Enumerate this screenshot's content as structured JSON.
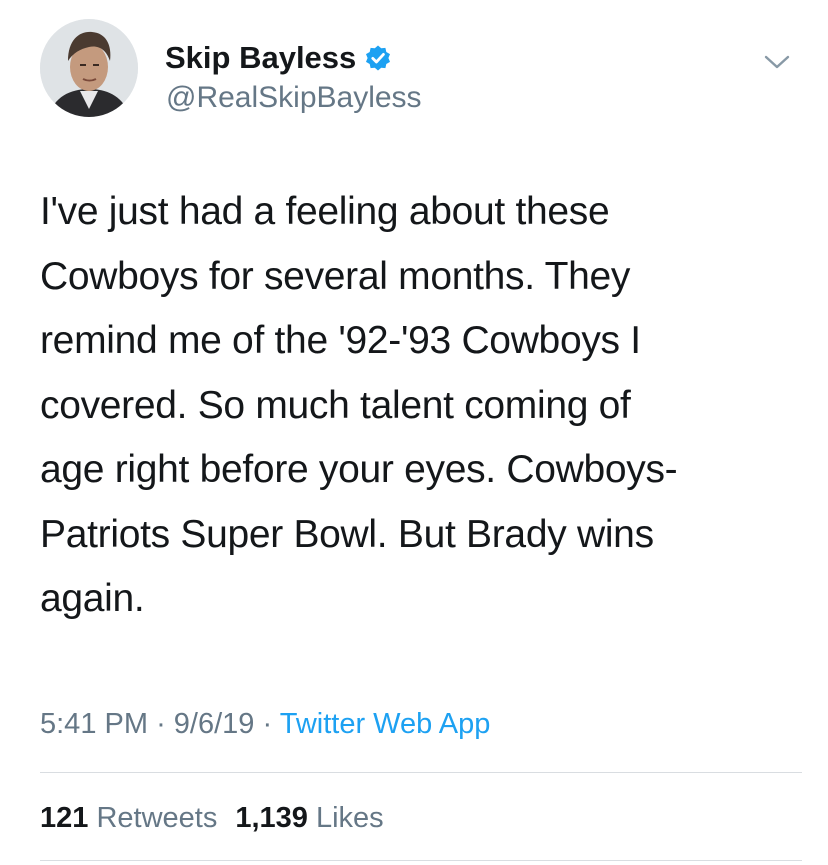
{
  "author": {
    "display_name": "Skip Bayless",
    "handle": "@RealSkipBayless",
    "verified": true
  },
  "tweet": {
    "lines": [
      "I've just had a feeling about these",
      "Cowboys for several months. They",
      "remind me of the '92-'93 Cowboys I",
      "covered. So much talent coming of",
      "age right before your eyes. Cowboys-",
      "Patriots Super Bowl. But Brady wins",
      "again."
    ],
    "time": "5:41 PM",
    "date": "9/6/19",
    "separator": "·",
    "source": "Twitter Web App"
  },
  "stats": {
    "retweets_count": "121",
    "retweets_label": "Retweets",
    "likes_count": "1,139",
    "likes_label": "Likes"
  },
  "icons": {
    "verified": "verified-badge-icon",
    "menu": "chevron-down-icon"
  },
  "colors": {
    "text": "#14171a",
    "secondary": "#657786",
    "accent": "#1da1f2",
    "divider": "#d9dde1"
  }
}
